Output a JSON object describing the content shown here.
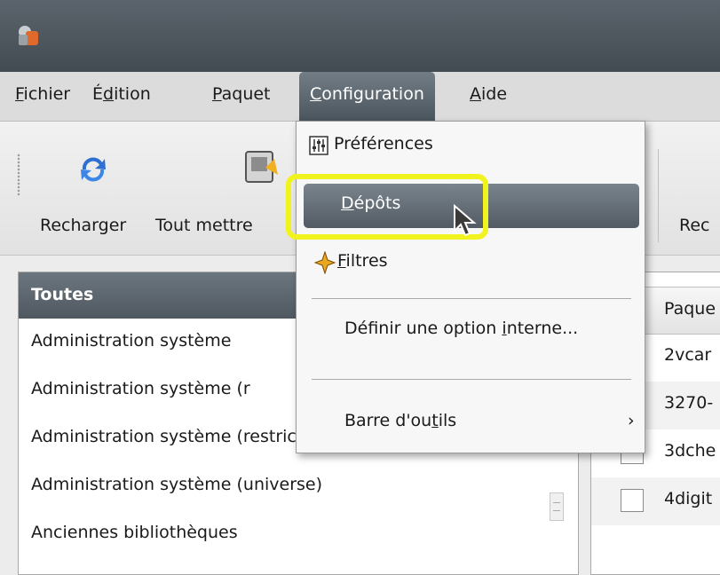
{
  "menubar": {
    "items": [
      {
        "label": "Fichier",
        "mnemonic": "F"
      },
      {
        "label": "Édition",
        "mnemonic": "d"
      },
      {
        "label": "Paquet",
        "mnemonic": "P"
      },
      {
        "label": "Configuration",
        "mnemonic": "C"
      },
      {
        "label": "Aide",
        "mnemonic": "A"
      }
    ]
  },
  "toolbar": {
    "reload_label": "Recharger",
    "upgrade_label": "Tout mettre",
    "right_label": "Rec"
  },
  "config_menu": {
    "items": [
      {
        "label": "Préférences",
        "icon": "preferences-icon"
      },
      {
        "label": "Dépôts",
        "mnemonic": "D",
        "state": "hovered"
      },
      {
        "label": "Filtres",
        "mnemonic": "F",
        "icon": "filter-icon"
      },
      {
        "label": "Définir une option interne...",
        "mnemonic": "i"
      },
      {
        "label": "Barre d'outils",
        "mnemonic": "t",
        "has_submenu": true
      }
    ],
    "submenu_arrow": "›"
  },
  "categories": {
    "header": "Toutes",
    "rows": [
      "Administration système",
      "Administration système (r",
      "Administration système (restricted)",
      "Administration système (universe)",
      "Anciennes bibliothèques"
    ]
  },
  "packages": {
    "header": "Paque",
    "rows": [
      "2vcar",
      "3270-",
      "3dche",
      "4digit"
    ]
  },
  "colors": {
    "highlight": "#f1f31e",
    "menu_active": "#5b646c",
    "titlebar": "#4a525a"
  }
}
